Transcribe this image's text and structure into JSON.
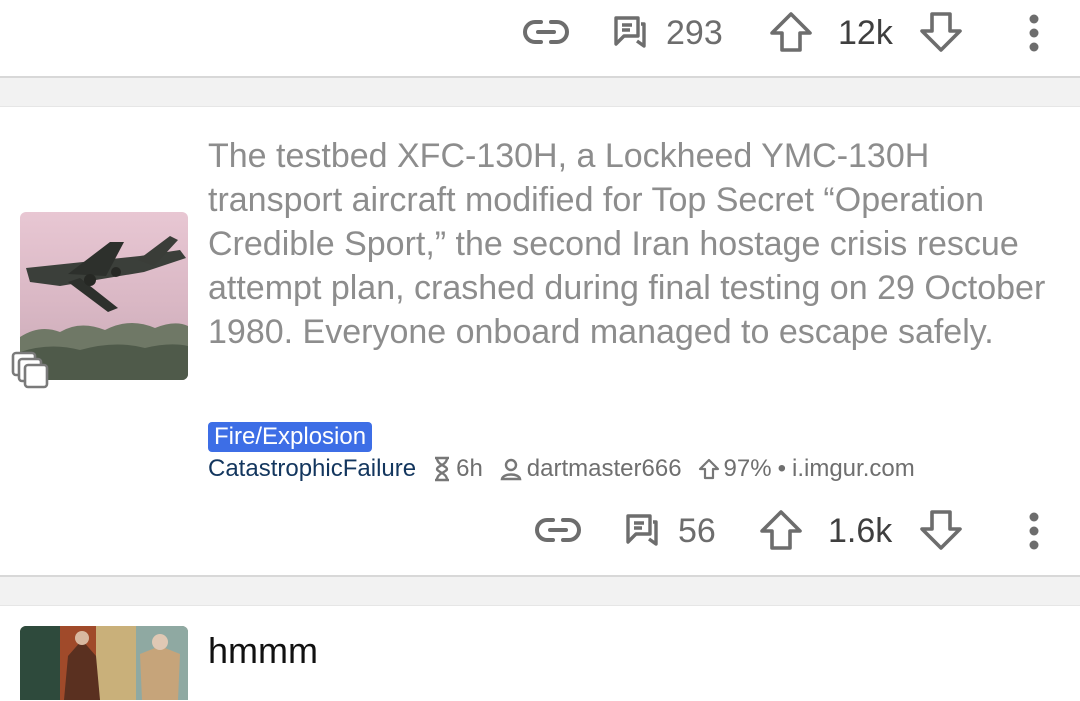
{
  "post_top": {
    "comments": "293",
    "score": "12k"
  },
  "post_main": {
    "title": "The testbed XFC-130H, a Lockheed YMC-130H transport aircraft modified for Top Secret “Operation Credible Sport,” the second Iran hostage crisis rescue attempt plan, crashed during final testing on 29 October 1980. Everyone onboard managed to escape safely.",
    "flair": "Fire/Explosion",
    "subreddit": "CatastrophicFailure",
    "age": "6h",
    "author": "dartmaster666",
    "upvote_ratio": "97%",
    "separator": "•",
    "domain": "i.imgur.com",
    "comments": "56",
    "score": "1.6k",
    "flair_color": "#3d6ee6"
  },
  "post_next": {
    "title": "hmmm"
  },
  "icons": [
    "link-icon",
    "comment-icon",
    "upvote-icon",
    "downvote-icon",
    "more-icon",
    "gallery-icon",
    "hourglass-icon",
    "user-icon",
    "arrow-up-icon"
  ]
}
